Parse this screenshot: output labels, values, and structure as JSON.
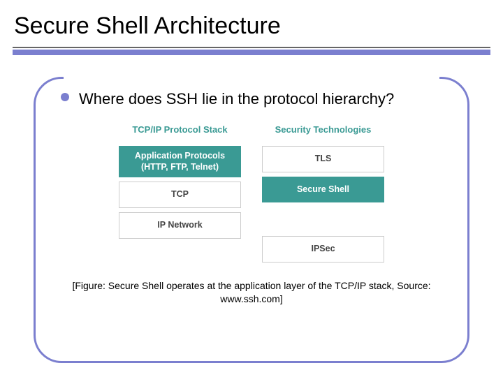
{
  "title": "Secure Shell Architecture",
  "bullet": "Where does SSH lie in the protocol hierarchy?",
  "diagram": {
    "left": {
      "header": "TCP/IP Protocol Stack",
      "app": "Application Protocols\n(HTTP, FTP, Telnet)",
      "tcp": "TCP",
      "ip": "IP Network"
    },
    "right": {
      "header": "Security Technologies",
      "tls": "TLS",
      "ssh": "Secure Shell",
      "ipsec": "IPSec"
    }
  },
  "caption": "[Figure: Secure Shell operates at the application layer of the TCP/IP stack, Source: www.ssh.com]"
}
